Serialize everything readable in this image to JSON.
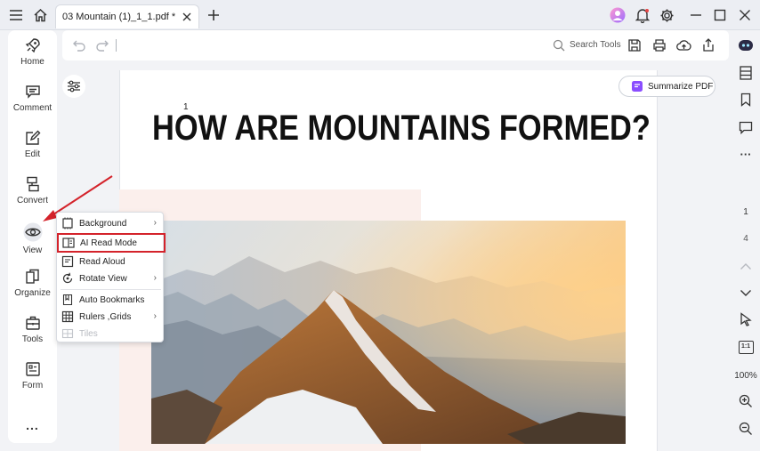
{
  "tab": {
    "title": "03 Mountain (1)_1_1.pdf *"
  },
  "sidebar": {
    "items": [
      {
        "label": "Home"
      },
      {
        "label": "Comment"
      },
      {
        "label": "Edit"
      },
      {
        "label": "Convert"
      },
      {
        "label": "View"
      },
      {
        "label": "Organize"
      },
      {
        "label": "Tools"
      },
      {
        "label": "Form"
      }
    ],
    "more": "..."
  },
  "toolbar": {
    "search_label": "Search Tools"
  },
  "document": {
    "page_marker": "1",
    "heading": "HOW ARE MOUNTAINS FORMED?"
  },
  "summarize_label": "Summarize PDF",
  "view_menu": {
    "items": [
      {
        "label": "Background",
        "has_submenu": true
      },
      {
        "label": "AI Read Mode",
        "has_submenu": false
      },
      {
        "label": "Read Aloud",
        "has_submenu": false
      },
      {
        "label": "Rotate View",
        "has_submenu": true
      },
      {
        "label": "Auto Bookmarks",
        "has_submenu": false
      },
      {
        "label": "Rulers ,Grids",
        "has_submenu": true
      },
      {
        "label": "Tiles",
        "has_submenu": false
      }
    ]
  },
  "page_nav": {
    "current": "1",
    "total": "4"
  },
  "zoom": {
    "level": "100%",
    "fit_label": "1:1"
  },
  "colors": {
    "accent": "#d4232b",
    "summarize_icon": "#8a4dff"
  }
}
